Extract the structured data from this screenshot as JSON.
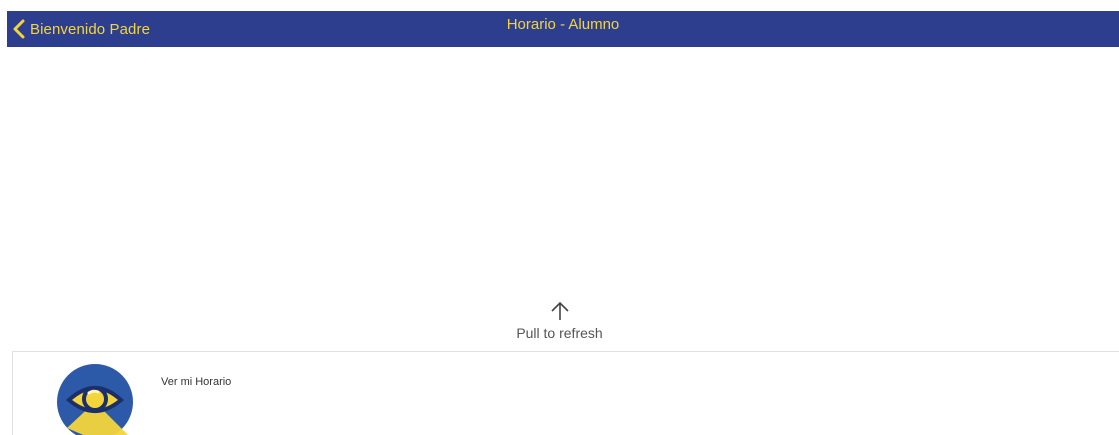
{
  "navbar": {
    "back_label": "Bienvenido Padre",
    "title": "Horario - Alumno",
    "background_color": "#2e3e8f",
    "text_color": "#f3d53b"
  },
  "refresh": {
    "icon": "arrow-up-icon",
    "text": "Pull to refresh"
  },
  "list": {
    "items": [
      {
        "label": "Ver mi Horario",
        "icon": "eye-icon"
      }
    ]
  }
}
